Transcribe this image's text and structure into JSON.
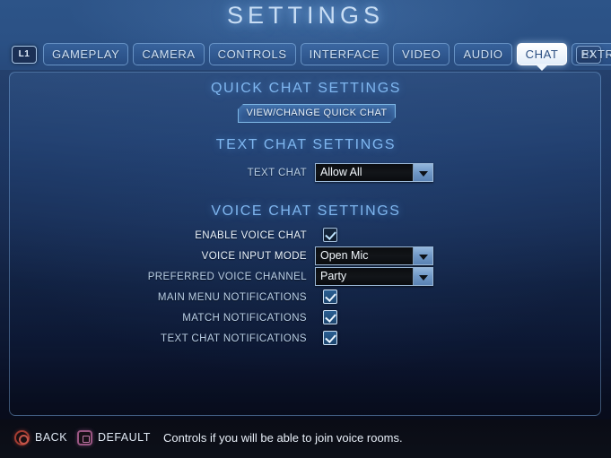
{
  "header": {
    "title": "SETTINGS",
    "shoulder_left": "L1",
    "shoulder_right": "R1"
  },
  "tabs": [
    {
      "label": "GAMEPLAY",
      "active": false
    },
    {
      "label": "CAMERA",
      "active": false
    },
    {
      "label": "CONTROLS",
      "active": false
    },
    {
      "label": "INTERFACE",
      "active": false
    },
    {
      "label": "VIDEO",
      "active": false
    },
    {
      "label": "AUDIO",
      "active": false
    },
    {
      "label": "CHAT",
      "active": true
    },
    {
      "label": "EXTRAS",
      "active": false
    }
  ],
  "sections": {
    "quick_chat": {
      "heading": "QUICK CHAT SETTINGS",
      "button_label": "VIEW/CHANGE QUICK CHAT"
    },
    "text_chat": {
      "heading": "TEXT CHAT SETTINGS",
      "rows": [
        {
          "label": "TEXT CHAT",
          "type": "dropdown",
          "value": "Allow All",
          "highlighted": false
        }
      ]
    },
    "voice_chat": {
      "heading": "VOICE CHAT SETTINGS",
      "rows": [
        {
          "label": "ENABLE VOICE CHAT",
          "type": "checkbox",
          "checked": true,
          "style": "dark",
          "highlighted": true
        },
        {
          "label": "VOICE INPUT MODE",
          "type": "dropdown",
          "value": "Open Mic",
          "highlighted": true
        },
        {
          "label": "PREFERRED VOICE CHANNEL",
          "type": "dropdown",
          "value": "Party",
          "highlighted": false
        },
        {
          "label": "MAIN MENU NOTIFICATIONS",
          "type": "checkbox",
          "checked": true,
          "style": "light",
          "highlighted": false
        },
        {
          "label": "MATCH NOTIFICATIONS",
          "type": "checkbox",
          "checked": true,
          "style": "light",
          "highlighted": false
        },
        {
          "label": "TEXT CHAT NOTIFICATIONS",
          "type": "checkbox",
          "checked": true,
          "style": "light",
          "highlighted": false
        }
      ]
    }
  },
  "footer": {
    "back_label": "BACK",
    "back_icon": "circle-button-icon",
    "default_label": "DEFAULT",
    "default_icon": "square-button-icon",
    "hint": "Controls if you will be able to join voice rooms."
  },
  "colors": {
    "accent": "#7fb6ef",
    "panel_border": "#82b4e6",
    "active_tab_bg": "#ffffff",
    "back_button": "#c4554a",
    "default_button": "#c078a9"
  }
}
